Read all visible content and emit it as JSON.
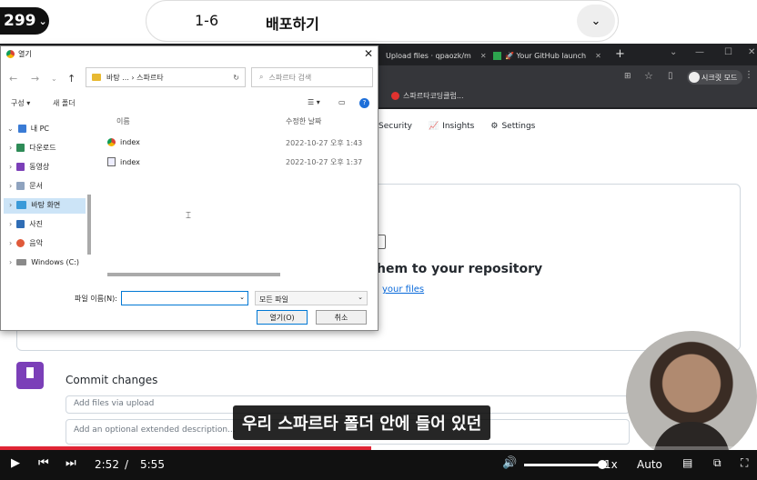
{
  "course": {
    "badge": "299",
    "lesson_no": "1-6",
    "lesson_title": "배포하기"
  },
  "browser": {
    "tabs": [
      {
        "title": "Upload files · qpaozk/m"
      },
      {
        "title": "🚀 Your GitHub launch"
      }
    ],
    "profile": "시크릿 모드",
    "bookmark": "스파르타코딩클럽..."
  },
  "github": {
    "nav": [
      "Security",
      "Insights",
      "Settings"
    ],
    "drag_title": "hem to your repository",
    "choose_link": "your files",
    "commit_title": "Commit changes",
    "commit_placeholder": "Add files via upload",
    "desc_placeholder": "Add an optional extended description..."
  },
  "dialog": {
    "title": "열기",
    "address": "바탕 ... › 스파르타",
    "search_placeholder": "스파르타 검색",
    "toolbar": {
      "organize": "구성 ▾",
      "new_folder": "새 폴더"
    },
    "sidebar": [
      "내 PC",
      "다운로드",
      "동영상",
      "문서",
      "바탕 화면",
      "사진",
      "음악",
      "Windows (C:)"
    ],
    "columns": {
      "name": "이름",
      "date": "수정한 날짜"
    },
    "files": [
      {
        "name": "index",
        "date": "2022-10-27 오후 1:43"
      },
      {
        "name": "index",
        "date": "2022-10-27 오후 1:37"
      }
    ],
    "filename_label": "파일 이름(N):",
    "filter": "모든 파일",
    "open_btn": "열기(O)",
    "cancel_btn": "취소"
  },
  "subtitle": "우리 스파르타 폴더 안에 들어 있던",
  "player": {
    "current": "2:52",
    "sep": "/",
    "duration": "5:55",
    "progress": 0.49,
    "volume": 0.95,
    "speed": "1x",
    "quality": "Auto"
  },
  "colors": {
    "progress": "#e02535",
    "link": "#0969da",
    "avatar": "#7b3fb8"
  }
}
